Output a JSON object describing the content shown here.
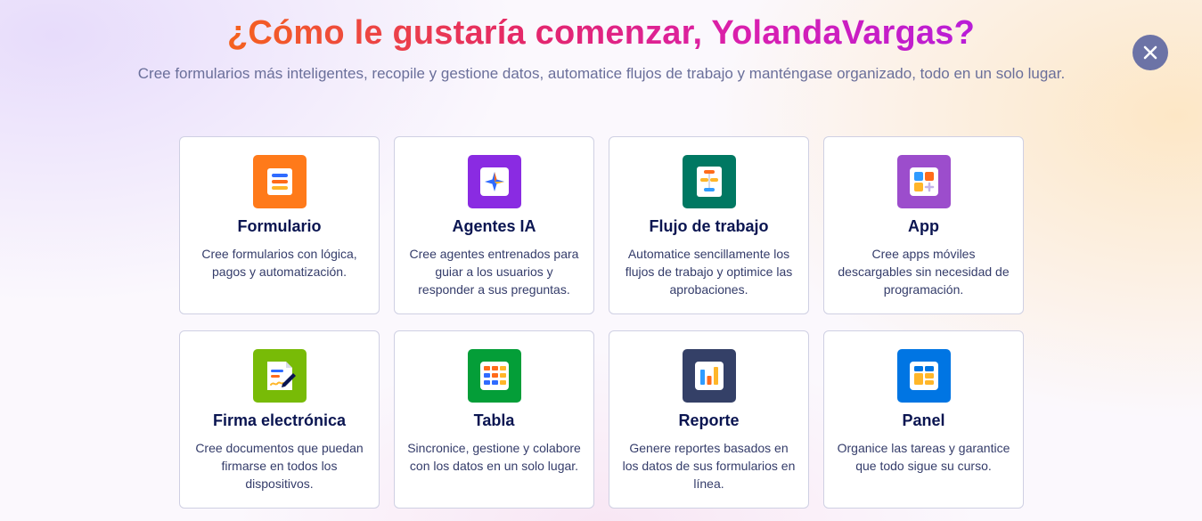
{
  "header": {
    "title": "¿Cómo le gustaría comenzar, YolandaVargas?",
    "subtitle": "Cree formularios más inteligentes, recopile y gestione datos, automatice flujos de trabajo y manténgase organizado, todo en un solo lugar."
  },
  "close_icon": "close-icon",
  "colors": {
    "formulario": "#ff7a1a",
    "agentes": "#8a2be2",
    "flujo": "#007862",
    "app": "#9c4dcc",
    "firma": "#78bb07",
    "tabla": "#049e38",
    "reporte": "#344067",
    "panel": "#0075e3"
  },
  "cards": [
    {
      "title": "Formulario",
      "description": "Cree formularios con lógica, pagos y automatización.",
      "icon": "form-icon"
    },
    {
      "title": "Agentes IA",
      "description": "Cree agentes entrenados para guiar a los usuarios y responder a sus preguntas.",
      "icon": "ai-agent-icon"
    },
    {
      "title": "Flujo de trabajo",
      "description": "Automatice sencillamente los flujos de trabajo y optimice las aprobaciones.",
      "icon": "workflow-icon"
    },
    {
      "title": "App",
      "description": "Cree apps móviles descargables sin necesidad de programación.",
      "icon": "app-icon"
    },
    {
      "title": "Firma electrónica",
      "description": "Cree documentos que puedan firmarse en todos los dispositivos.",
      "icon": "signature-icon"
    },
    {
      "title": "Tabla",
      "description": "Sincronice, gestione y colabore con los datos en un solo lugar.",
      "icon": "table-icon"
    },
    {
      "title": "Reporte",
      "description": "Genere reportes basados en los datos de sus formularios en línea.",
      "icon": "report-icon"
    },
    {
      "title": "Panel",
      "description": "Organice las tareas y garantice que todo sigue su curso.",
      "icon": "board-icon"
    }
  ]
}
